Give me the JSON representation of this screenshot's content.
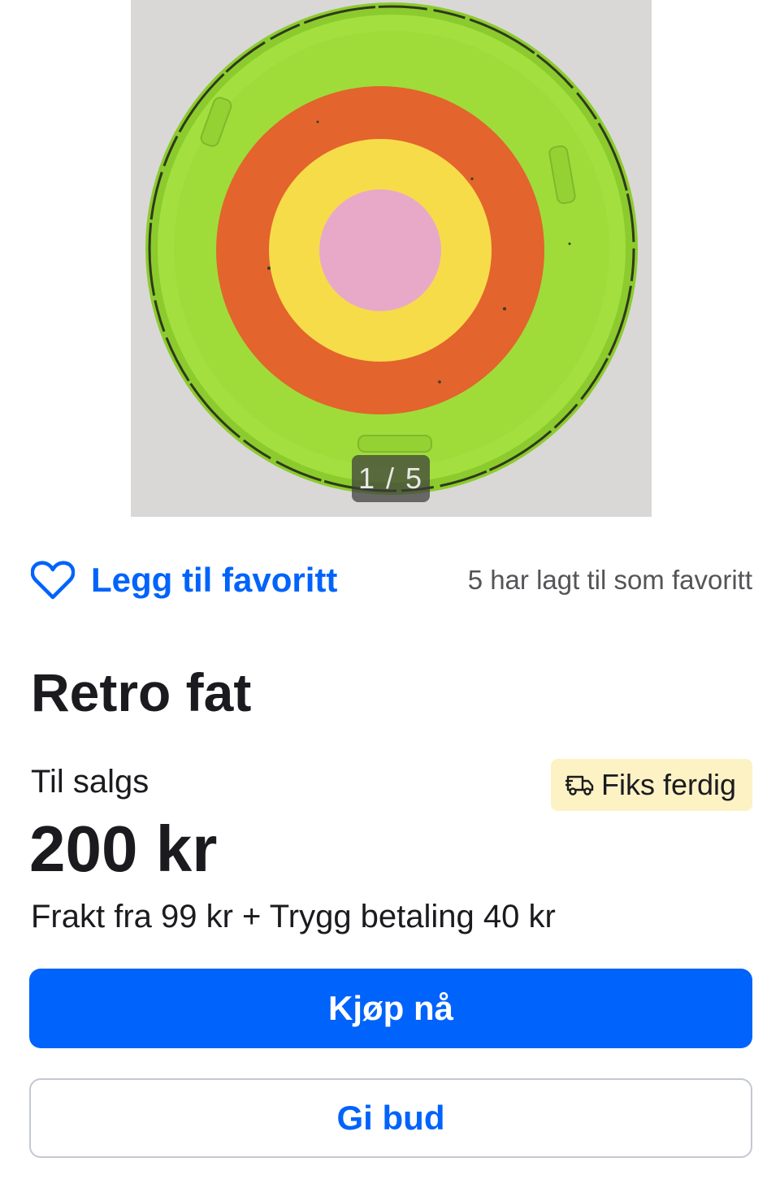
{
  "gallery": {
    "image_alt": "Round green tray with orange, yellow and pink concentric circles",
    "counter": "1 / 5",
    "colors": {
      "background": "#d9d8d6",
      "tray_green": "#9fdc3a",
      "ring_orange": "#e3642c",
      "ring_yellow": "#f7dc4a",
      "center_pink": "#e8a9c8"
    }
  },
  "favorite": {
    "label": "Legg til favoritt",
    "count_text": "5 har lagt til som favoritt",
    "icon": "heart-icon"
  },
  "listing": {
    "title": "Retro fat",
    "status": "Til salgs",
    "price": "200 kr",
    "shipping": "Frakt fra 99 kr + Trygg betaling 40 kr",
    "badge": {
      "label": "Fiks ferdig",
      "icon": "delivery-truck-icon"
    }
  },
  "actions": {
    "buy_label": "Kjøp nå",
    "bid_label": "Gi bud"
  },
  "theme": {
    "accent": "#0063fb",
    "badge_bg": "#fdf2c4",
    "text": "#1b1b1f",
    "muted": "#555558"
  }
}
